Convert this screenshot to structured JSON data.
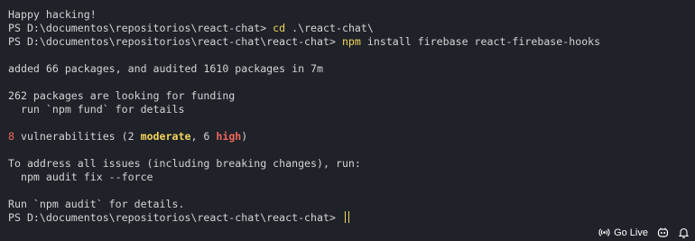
{
  "terminal": {
    "lines": {
      "l1": "Happy hacking!",
      "l2_prompt": "PS D:\\documentos\\repositorios\\react-chat> ",
      "l2_cmd": "cd",
      "l2_args": " .\\react-chat\\",
      "l3_prompt": "PS D:\\documentos\\repositorios\\react-chat\\react-chat> ",
      "l3_cmd": "npm",
      "l3_args": " install firebase react-firebase-hooks",
      "l5": "added 66 packages, and audited 1610 packages in 7m",
      "l7": "262 packages are looking for funding",
      "l8": "  run `npm fund` for details",
      "l10_count": "8",
      "l10_mid": " vulnerabilities (2 ",
      "l10_moderate": "moderate",
      "l10_sep": ", 6 ",
      "l10_high": "high",
      "l10_end": ")",
      "l12": "To address all issues (including breaking changes), run:",
      "l13": "  npm audit fix --force",
      "l15": "Run `npm audit` for details.",
      "l16_prompt": "PS D:\\documentos\\repositorios\\react-chat\\react-chat> "
    }
  },
  "statusbar": {
    "go_live_label": "Go Live",
    "icons": [
      "broadcast-icon",
      "copilot-icon",
      "bell-icon"
    ]
  },
  "colors": {
    "background": "#1f2229",
    "text": "#d4d4d4",
    "command": "#f2d65a",
    "error": "#f0675c"
  }
}
